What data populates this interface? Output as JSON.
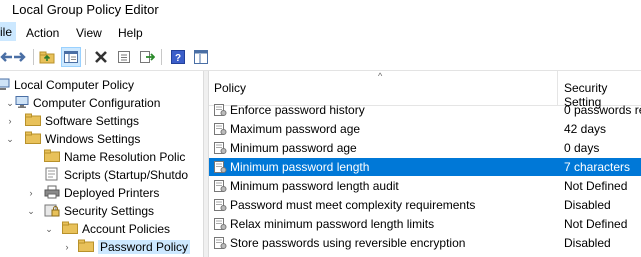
{
  "window": {
    "title": "Local Group Policy Editor"
  },
  "menu": [
    "ile",
    "Action",
    "View",
    "Help"
  ],
  "toolbar_icons": [
    "forward-arrow-icon",
    "up-folder-icon",
    "show-hide-tree-icon",
    "delete-icon",
    "properties-icon",
    "export-list-icon",
    "help-icon",
    "extended-view-icon"
  ],
  "tree": [
    {
      "label": "Local Computer Policy",
      "icon": "computer-policy-icon"
    },
    {
      "label": "Computer Configuration",
      "icon": "computer-icon"
    },
    {
      "label": "Software Settings",
      "icon": "folder-icon"
    },
    {
      "label": "Windows Settings",
      "icon": "folder-icon"
    },
    {
      "label": "Name Resolution Polic",
      "icon": "folder-icon"
    },
    {
      "label": "Scripts (Startup/Shutdo",
      "icon": "script-icon"
    },
    {
      "label": "Deployed Printers",
      "icon": "printer-icon"
    },
    {
      "label": "Security Settings",
      "icon": "security-icon"
    },
    {
      "label": "Account Policies",
      "icon": "folder-icon"
    },
    {
      "label": "Password Policy",
      "icon": "folder-icon"
    }
  ],
  "columns": {
    "policy": "Policy",
    "setting": "Security Setting"
  },
  "policies": [
    {
      "name": "Enforce password history",
      "value": "0 passwords re"
    },
    {
      "name": "Maximum password age",
      "value": "42 days"
    },
    {
      "name": "Minimum password age",
      "value": "0 days"
    },
    {
      "name": "Minimum password length",
      "value": "7 characters",
      "selected": true
    },
    {
      "name": "Minimum password length audit",
      "value": "Not Defined"
    },
    {
      "name": "Password must meet complexity requirements",
      "value": "Disabled"
    },
    {
      "name": "Relax minimum password length limits",
      "value": "Not Defined"
    },
    {
      "name": "Store passwords using reversible encryption",
      "value": "Disabled"
    }
  ],
  "colors": {
    "selection": "#0078d7",
    "menu_highlight": "#cce8ff",
    "folder": "#e8c15a"
  }
}
